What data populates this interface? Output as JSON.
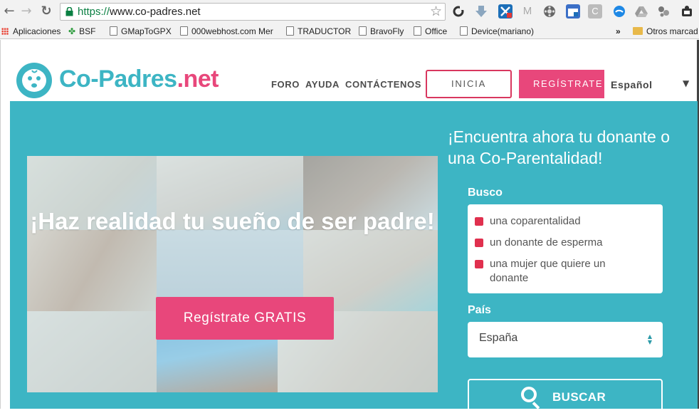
{
  "browser": {
    "url_scheme": "https://",
    "url_rest": "www.co-padres.net",
    "bookmarks": [
      {
        "label": "Aplicaciones"
      },
      {
        "label": "BSF"
      },
      {
        "label": "GMapToGPX"
      },
      {
        "label": "000webhost.com Mer"
      },
      {
        "label": "TRADUCTOR"
      },
      {
        "label": "BravoFly"
      },
      {
        "label": "Office"
      },
      {
        "label": "Device(mariano)"
      }
    ],
    "more_label": "»",
    "other_bookmarks": "Otros marcad"
  },
  "header": {
    "logo_main": "Co-Padres",
    "logo_tld": ".net",
    "nav": [
      {
        "label": "FORO"
      },
      {
        "label": "AYUDA"
      },
      {
        "label": "CONTÁCTENOS"
      }
    ],
    "login_label": "INICIA",
    "register_label": "REGÍSTRATE",
    "language": "Español"
  },
  "hero": {
    "title": "¡Haz realidad tu sueño de ser padre!",
    "cta_label": "Regístrate GRATIS"
  },
  "search": {
    "title": "¡Encuentra ahora tu donante o una Co-Parentalidad!",
    "busco_label": "Busco",
    "options": [
      {
        "label": "una coparentalidad"
      },
      {
        "label": "un donante de esperma"
      },
      {
        "label": "una mujer que quiere un donante"
      }
    ],
    "pais_label": "País",
    "pais_value": "España",
    "button_label": "BUSCAR"
  },
  "colors": {
    "brand_teal": "#3db5c4",
    "brand_pink": "#e8477b",
    "checkbox_red": "#e0304e"
  }
}
